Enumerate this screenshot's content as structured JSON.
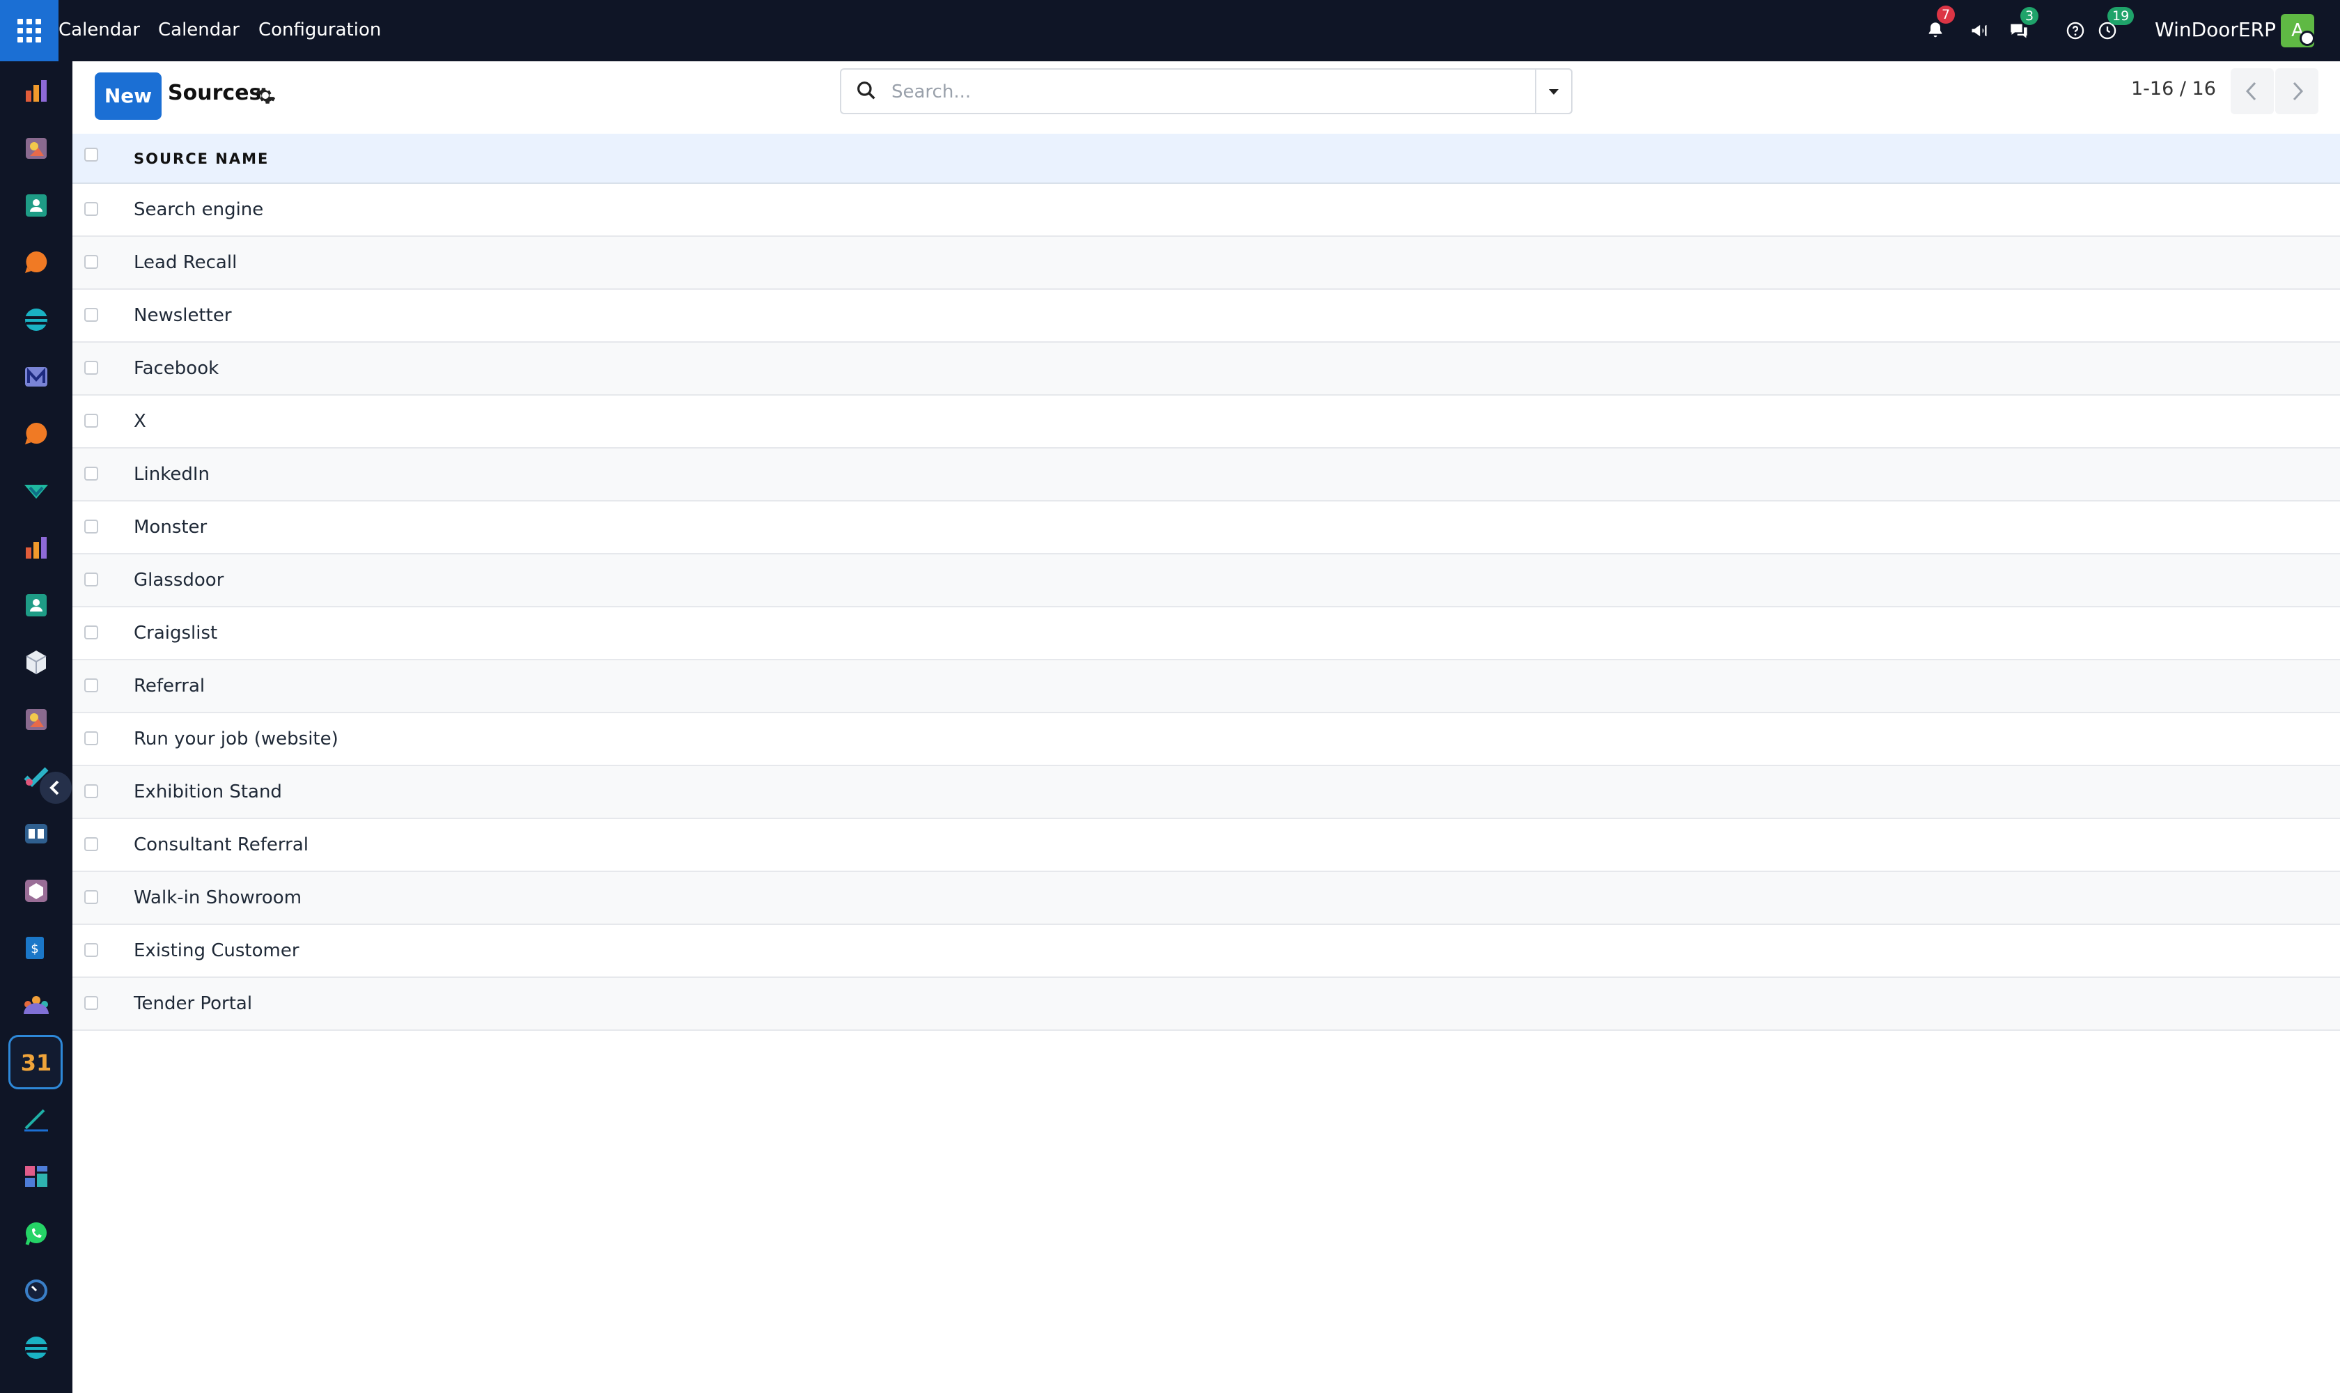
{
  "topbar": {
    "menu": [
      "Calendar",
      "Calendar",
      "Configuration"
    ],
    "notifications_count": "7",
    "messages_count": "3",
    "activities_count": "19",
    "company": "WinDoorERP",
    "avatar_initial": "A",
    "brand_color": "#1b6fd4",
    "bar_color": "#0f1526"
  },
  "sidebar": {
    "apps": [
      "dashboard-icon",
      "creative-icon",
      "contacts-icon",
      "chat-bubble-icon",
      "globe-icon",
      "mail-icon",
      "chat-bubble-icon",
      "verified-icon",
      "dashboard-icon",
      "contacts-icon",
      "package-icon",
      "creative-icon",
      "checkmark-icon",
      "book-icon",
      "box-icon",
      "invoice-icon",
      "team-icon",
      "calendar-icon",
      "sign-icon",
      "dashboards-icon",
      "whatsapp-icon",
      "timer-icon",
      "globe-icon"
    ],
    "active_app": "calendar-icon",
    "active_label": "31"
  },
  "control_panel": {
    "new_label": "New",
    "title": "Sources",
    "search_placeholder": "Search...",
    "pager_value": "1-16 / 16"
  },
  "list": {
    "column_header": "SOURCE NAME",
    "rows": [
      "Search engine",
      "Lead Recall",
      "Newsletter",
      "Facebook",
      "X",
      "LinkedIn",
      "Monster",
      "Glassdoor",
      "Craigslist",
      "Referral",
      "Run your job (website)",
      "Exhibition Stand",
      "Consultant Referral",
      "Walk-in Showroom",
      "Existing Customer",
      "Tender Portal"
    ]
  }
}
